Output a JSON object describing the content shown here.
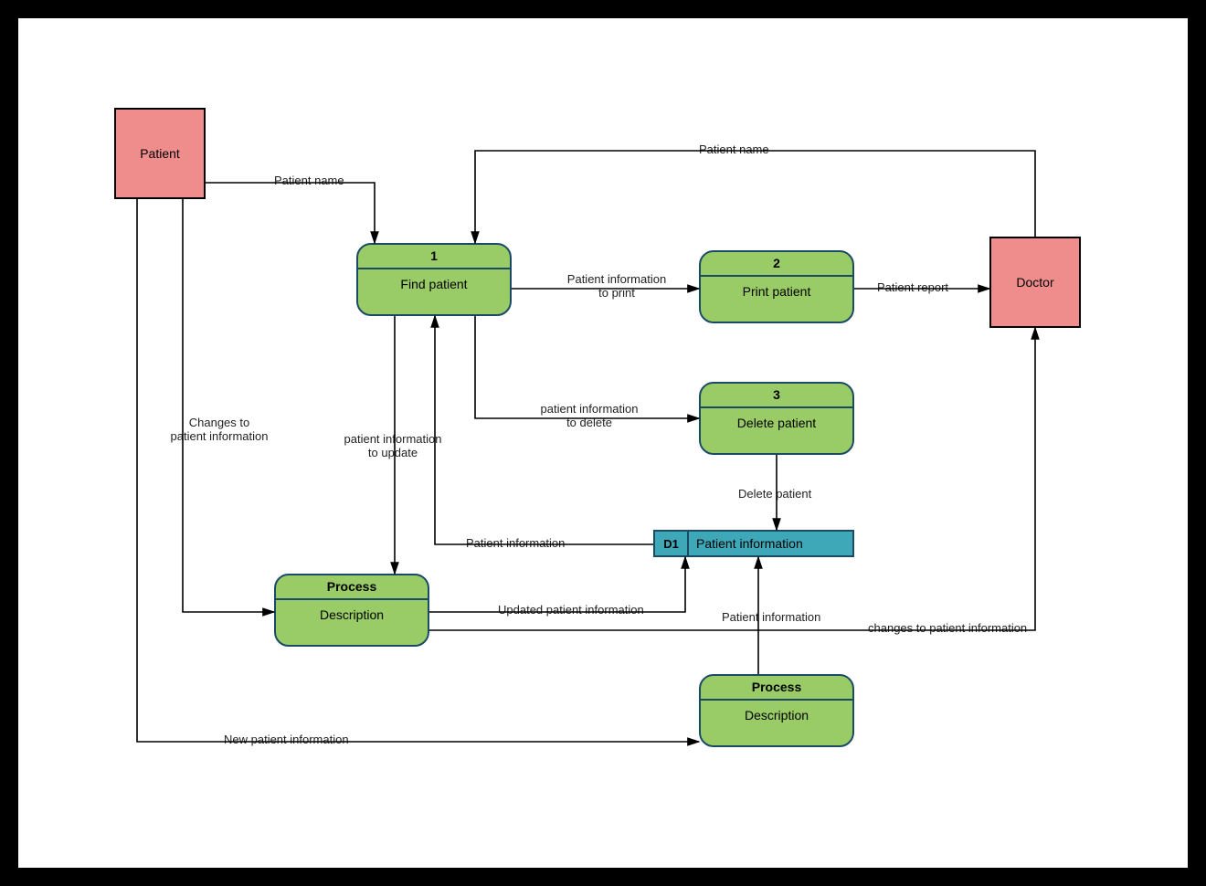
{
  "entities": {
    "patient": "Patient",
    "doctor": "Doctor"
  },
  "processes": {
    "p1": {
      "id": "1",
      "name": "Find patient"
    },
    "p2": {
      "id": "2",
      "name": "Print patient"
    },
    "p3": {
      "id": "3",
      "name": "Delete patient"
    },
    "p4": {
      "id": "Process",
      "name": "Description"
    },
    "p5": {
      "id": "Process",
      "name": "Description"
    }
  },
  "datastores": {
    "d1": {
      "id": "D1",
      "name": "Patient information"
    }
  },
  "flows": {
    "f1": "Patient name",
    "f2": "Patient name",
    "f3": "Patient information\nto print",
    "f4": "Patient report",
    "f5": "patient information\nto delete",
    "f6": "Delete patient",
    "f7": "Patient information",
    "f8": "patient information\nto update",
    "f9": "Updated patient information",
    "f10": "Changes to\npatient information",
    "f11": "changes to patient information",
    "f12": "Patient information",
    "f13": "New patient information"
  }
}
